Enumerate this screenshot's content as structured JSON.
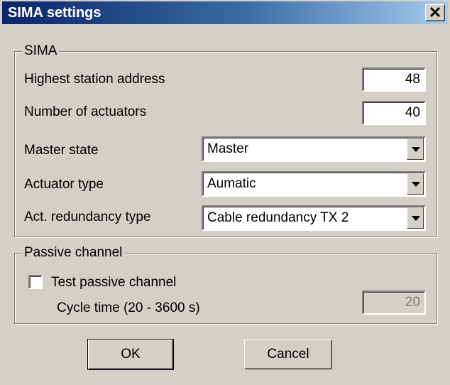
{
  "window": {
    "title": "SIMA settings",
    "close_glyph": "✕"
  },
  "sima_group": {
    "legend": "SIMA",
    "highest_station_address": {
      "label": "Highest station address",
      "value": "48"
    },
    "number_of_actuators": {
      "label": "Number of actuators",
      "value": "40"
    },
    "master_state": {
      "label": "Master state",
      "value": "Master"
    },
    "actuator_type": {
      "label": "Actuator type",
      "value": "Aumatic"
    },
    "redundancy_type": {
      "label": "Act. redundancy type",
      "value": "Cable redundancy TX 2"
    }
  },
  "passive_group": {
    "legend": "Passive channel",
    "test_label": "Test passive channel",
    "test_checked": false,
    "cycle_label": "Cycle time (20 - 3600 s)",
    "cycle_value": "20"
  },
  "buttons": {
    "ok": "OK",
    "cancel": "Cancel"
  }
}
